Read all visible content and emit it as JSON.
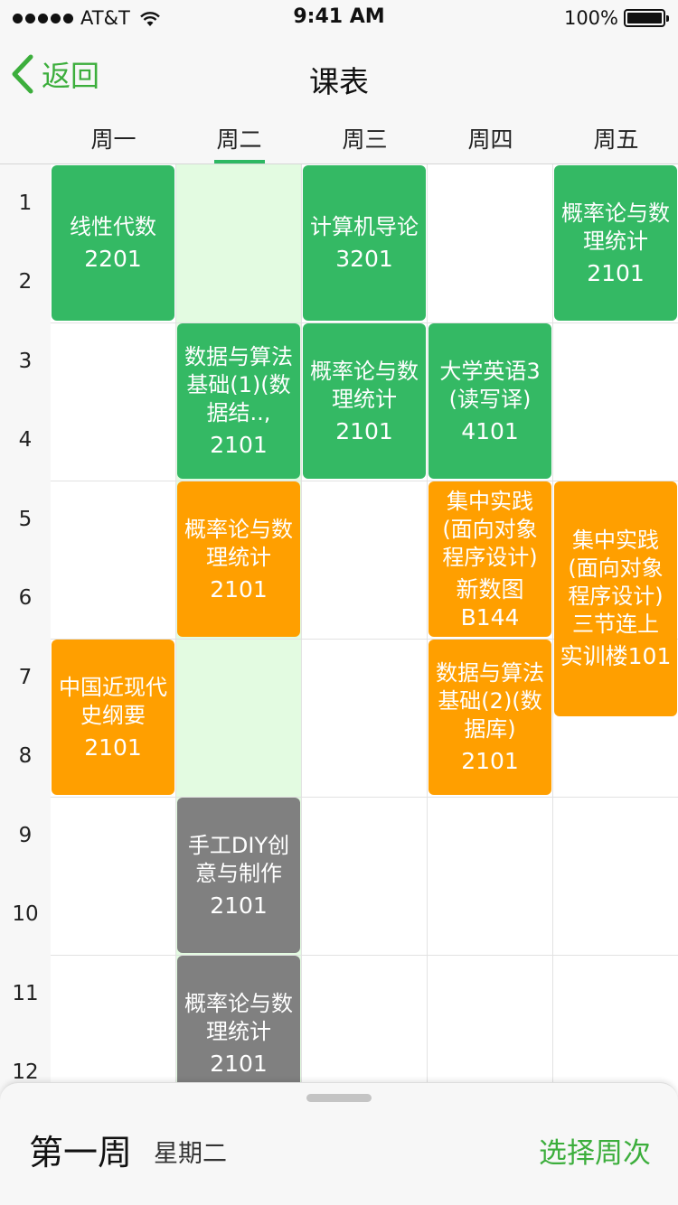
{
  "status_bar": {
    "carrier": "AT&T",
    "time": "9:41 AM",
    "battery": "100%",
    "battery_level": 1.0
  },
  "nav": {
    "back_label": "返回",
    "title": "课表"
  },
  "days": [
    "周一",
    "周二",
    "周三",
    "周四",
    "周五"
  ],
  "selected_day": "周二",
  "periods": [
    "1",
    "2",
    "3",
    "4",
    "5",
    "6",
    "7",
    "8",
    "9",
    "10",
    "11",
    "12"
  ],
  "courses": [
    {
      "name": "线性代数",
      "room": "2201",
      "day": "周一",
      "start": 1,
      "end": 2,
      "color": "#34b964"
    },
    {
      "name": "计算机导论",
      "room": "3201",
      "day": "周三",
      "start": 1,
      "end": 2,
      "color": "#34b964"
    },
    {
      "name": "概率论与数理统计",
      "room": "2101",
      "day": "周五",
      "start": 1,
      "end": 2,
      "color": "#34b964"
    },
    {
      "name": "数据与算法基础(1)(数据结..,",
      "room": "2101",
      "day": "周二",
      "start": 3,
      "end": 4,
      "color": "#34b964"
    },
    {
      "name": "概率论与数理统计",
      "room": "2101",
      "day": "周三",
      "start": 3,
      "end": 4,
      "color": "#34b964"
    },
    {
      "name": "大学英语3(读写译)",
      "room": "4101",
      "day": "周四",
      "start": 3,
      "end": 4,
      "color": "#34b964"
    },
    {
      "name": "概率论与数理统计",
      "room": "2101",
      "day": "周二",
      "start": 5,
      "end": 6,
      "color": "#ff9f00"
    },
    {
      "name": "集中实践(面向对象程序设计)",
      "room": "新数图B144",
      "day": "周四",
      "start": 5,
      "end": 6,
      "color": "#ff9f00"
    },
    {
      "name": "集中实践(面向对象程序设计)三节连上",
      "room": "实训楼101",
      "day": "周五",
      "start": 5,
      "end": 7,
      "color": "#ff9f00"
    },
    {
      "name": "中国近现代史纲要",
      "room": "2101",
      "day": "周一",
      "start": 7,
      "end": 8,
      "color": "#ff9f00"
    },
    {
      "name": "数据与算法基础(2)(数据库)",
      "room": "2101",
      "day": "周四",
      "start": 7,
      "end": 8,
      "color": "#ff9f00"
    },
    {
      "name": "手工DIY创意与制作",
      "room": "2101",
      "day": "周二",
      "start": 9,
      "end": 10,
      "color": "#808080"
    },
    {
      "name": "概率论与数理统计",
      "room": "2101",
      "day": "周二",
      "start": 11,
      "end": 12,
      "color": "#808080"
    }
  ],
  "bottom_sheet": {
    "week": "第一周",
    "day": "星期二",
    "action": "选择周次"
  }
}
